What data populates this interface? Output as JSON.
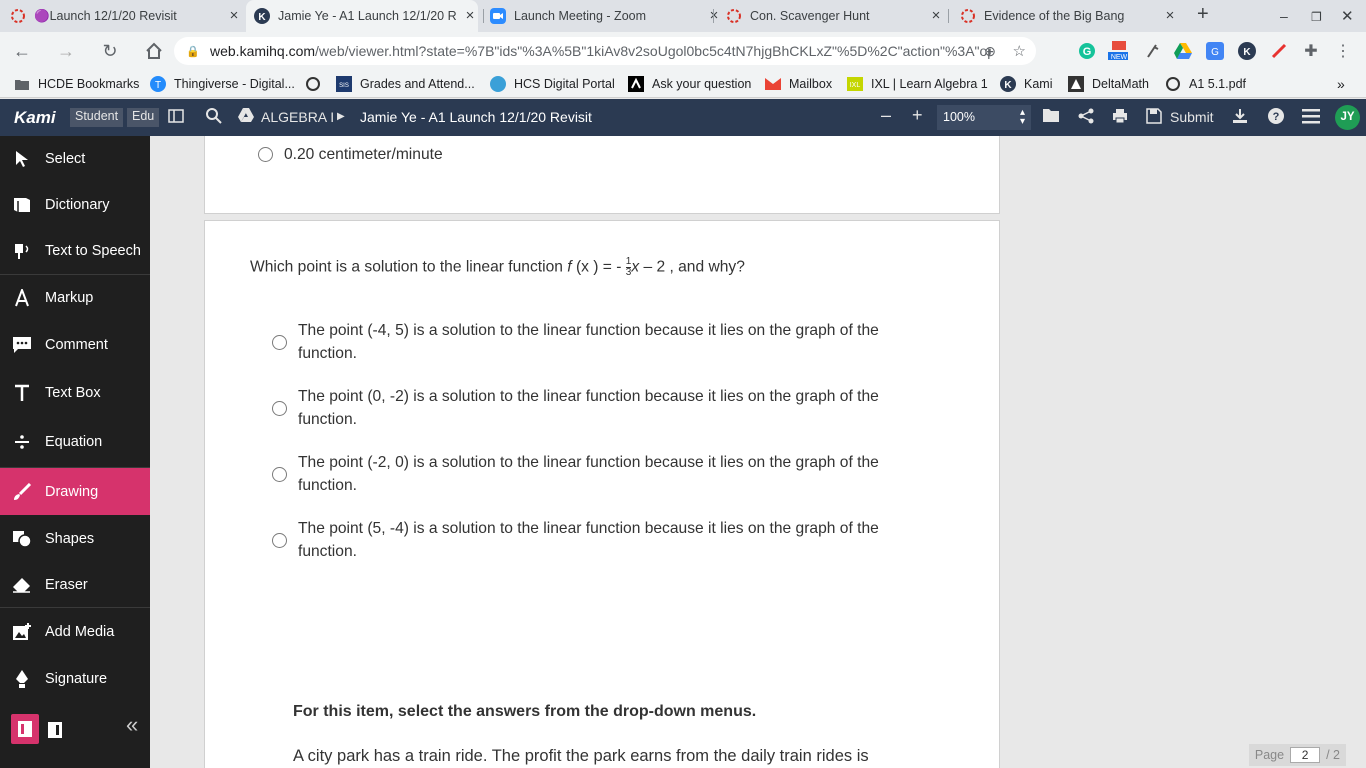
{
  "tabs": [
    {
      "label": "🟣Launch 12/1/20 Revisit",
      "active": false
    },
    {
      "label": "Jamie Ye - A1 Launch 12/1/20 R",
      "active": true
    },
    {
      "label": "Launch Meeting - Zoom",
      "active": false
    },
    {
      "label": "Con. Scavenger Hunt",
      "active": false
    },
    {
      "label": "Evidence of the Big Bang",
      "active": false
    }
  ],
  "address": {
    "host": "web.kamihq.com",
    "path": "/web/viewer.html?state=%7B\"ids\"%3A%5B\"1kiAv8v2soUgol0bc5c4tN7hjgBhCKLxZ\"%5D%2C\"action\"%3A\"op..."
  },
  "bookmarks": [
    "HCDE Bookmarks",
    "Thingiverse - Digital...",
    "Grades and Attend...",
    "HCS Digital Portal",
    "Ask your question",
    "Mailbox",
    "IXL | Learn Algebra 1",
    "Kami",
    "DeltaMath",
    "A1 5.1.pdf"
  ],
  "kami": {
    "logo": "Kami",
    "badge_student": "Student",
    "badge_edu": "Edu",
    "breadcrumb_folder": "ALGEBRA I",
    "breadcrumb_doc": "Jamie Ye - A1 Launch 12/1/20 Revisit",
    "zoom": "100%",
    "submit": "Submit",
    "avatar": "JY"
  },
  "tools": [
    "Select",
    "Dictionary",
    "Text to Speech",
    "Markup",
    "Comment",
    "Text Box",
    "Equation",
    "Drawing",
    "Shapes",
    "Eraser",
    "Add Media",
    "Signature"
  ],
  "active_tool": "Drawing",
  "drawing": {
    "stroke_size": "2",
    "colors": [
      "#e8322f",
      "#1010e0",
      "#000000"
    ],
    "selected_color": "#1010e0"
  },
  "doc": {
    "prev_option": "0.20 centimeter/minute",
    "question_prefix": "Which point is a solution to the linear function ",
    "question_f": "f",
    "question_fx": " (x ) = - ",
    "frac_num": "1",
    "frac_den": "3",
    "question_x": "x",
    "question_suffix": " – 2 , and why?",
    "options": [
      {
        "line1": "The point (-4, 5) is a solution to the linear function because it lies on the graph of the",
        "line2": "function."
      },
      {
        "line1": "The point (0, -2) is a solution to the linear function because it lies on the graph of the",
        "line2": "function."
      },
      {
        "line1": "The point (-2, 0) is a solution to the linear function because it lies on the graph of the",
        "line2": "function."
      },
      {
        "line1": "The point (5, -4) is a solution to the linear function because it lies on the graph of the",
        "line2": "function."
      }
    ],
    "instruction": "For this item, select the answers from the drop-down menus.",
    "passage": "A city park has a train ride. The profit the park earns from the daily train rides is"
  },
  "pager": {
    "label": "Page",
    "current": "2",
    "total": "/ 2"
  }
}
